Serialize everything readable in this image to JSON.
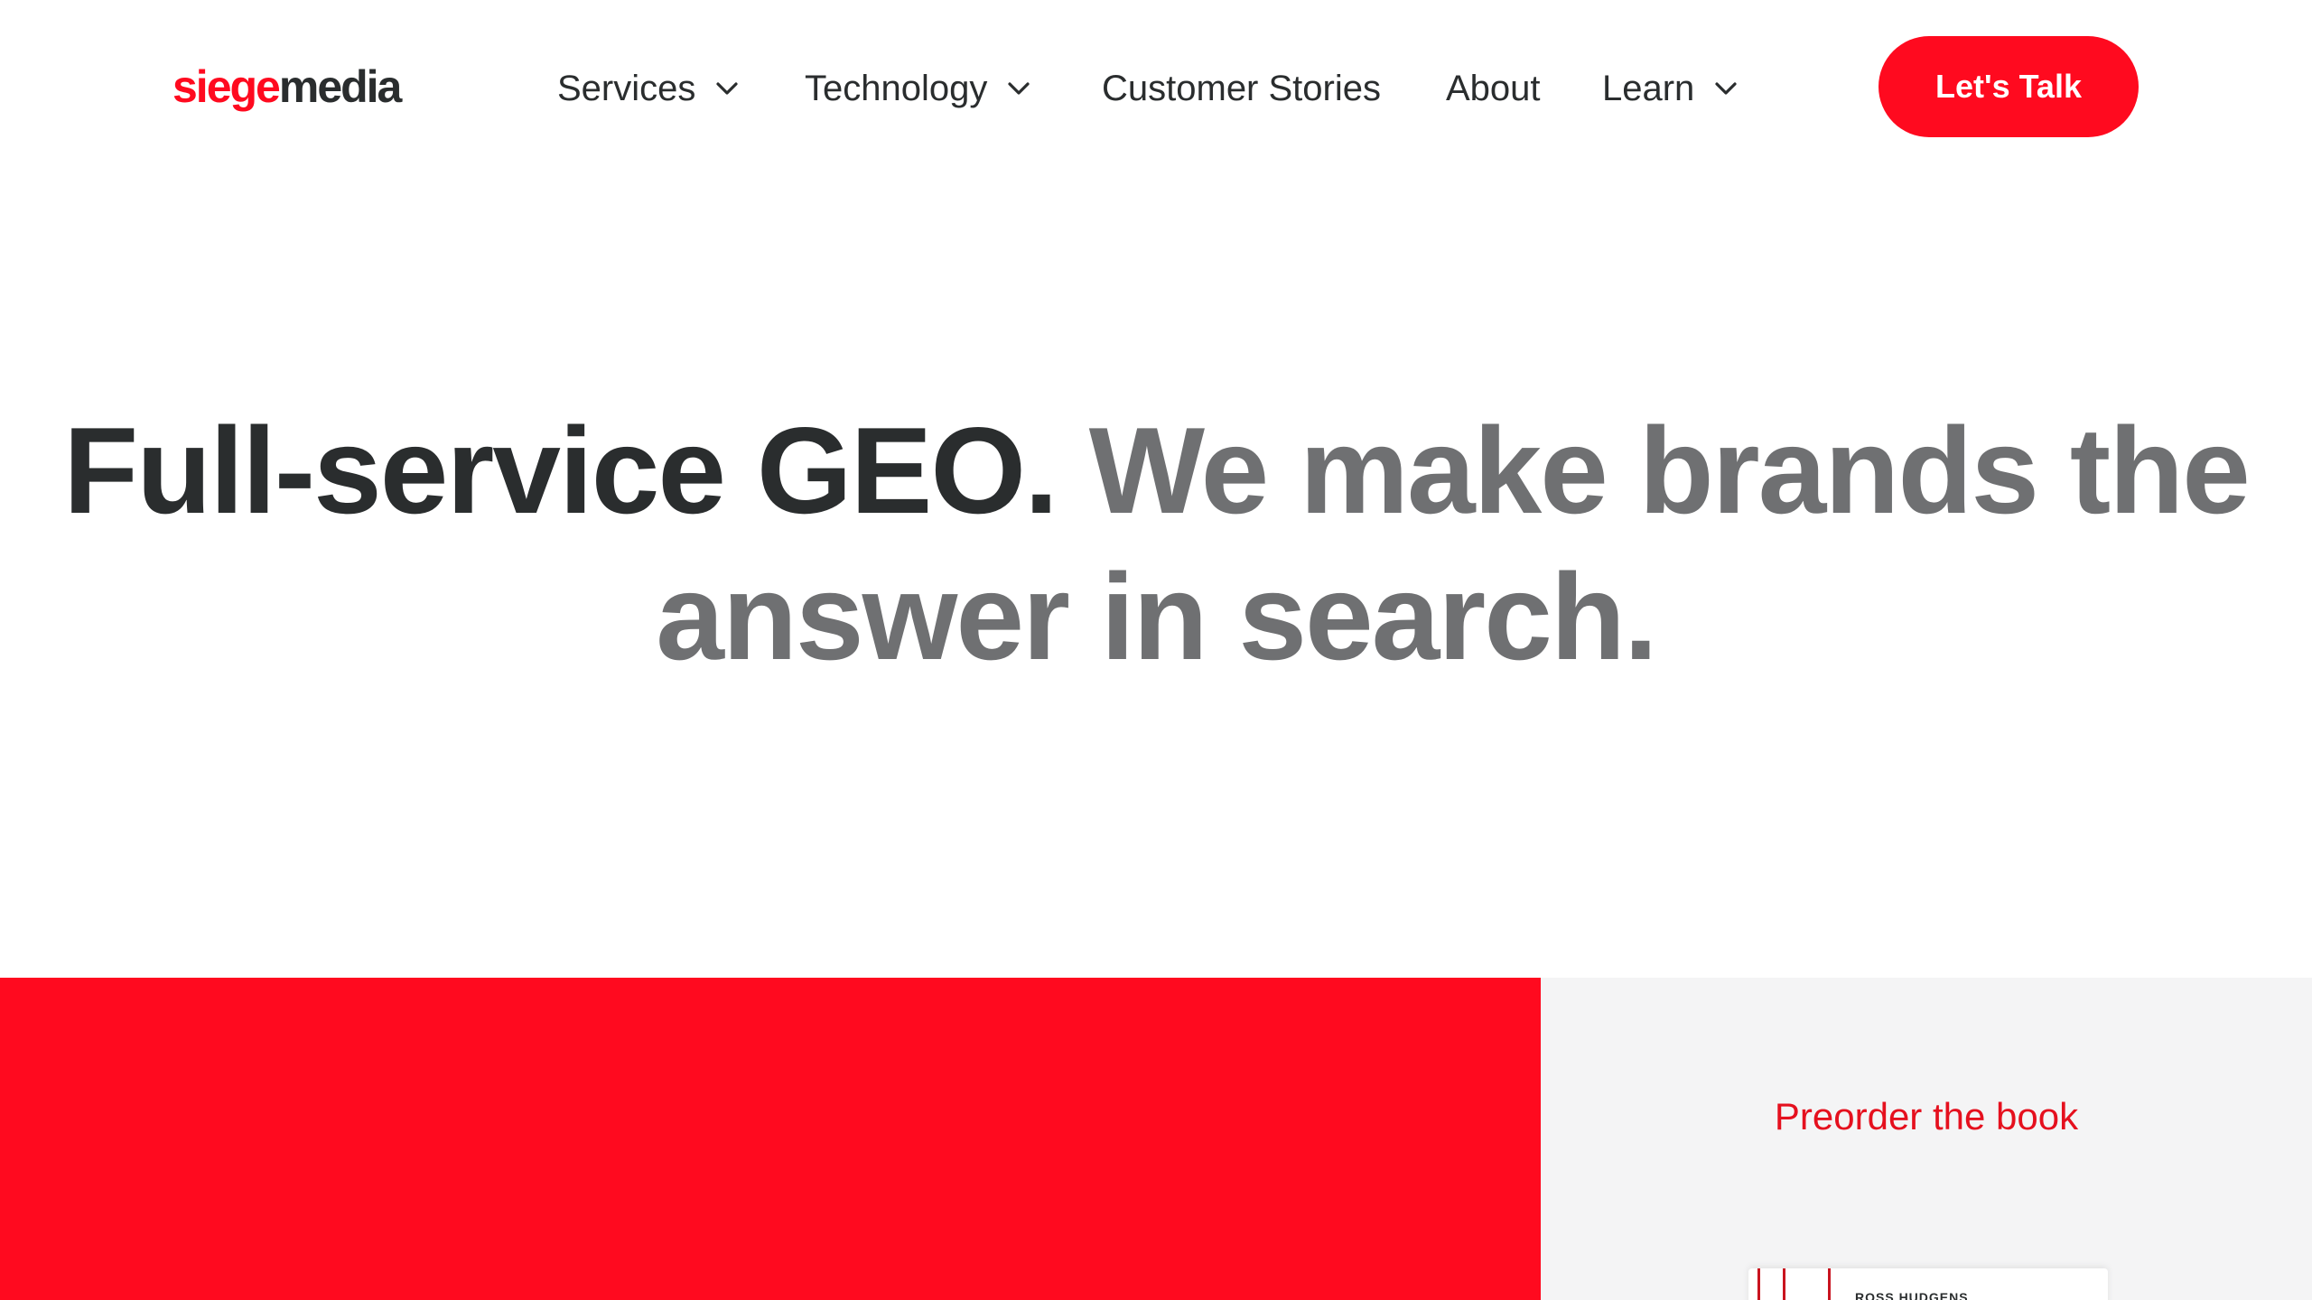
{
  "header": {
    "logo": {
      "part1": "siege",
      "part2": "media"
    },
    "nav": [
      {
        "label": "Services",
        "has_dropdown": true
      },
      {
        "label": "Technology",
        "has_dropdown": true
      },
      {
        "label": "Customer Stories",
        "has_dropdown": false
      },
      {
        "label": "About",
        "has_dropdown": false
      },
      {
        "label": "Learn",
        "has_dropdown": true
      }
    ],
    "cta_label": "Let's Talk"
  },
  "hero": {
    "headline_dark": "Full-service GEO.",
    "headline_gray": "We make brands the answer in search."
  },
  "promo": {
    "preorder_label": "Preorder the book",
    "book_cover_text": "ROSS HUDGENS"
  },
  "colors": {
    "brand_red": "#ff0a1f",
    "text_dark": "#2a2d2e",
    "text_gray": "#6f7072",
    "panel_gray": "#f4f4f5"
  },
  "icons": {
    "dropdown": "chevron-down-icon"
  }
}
